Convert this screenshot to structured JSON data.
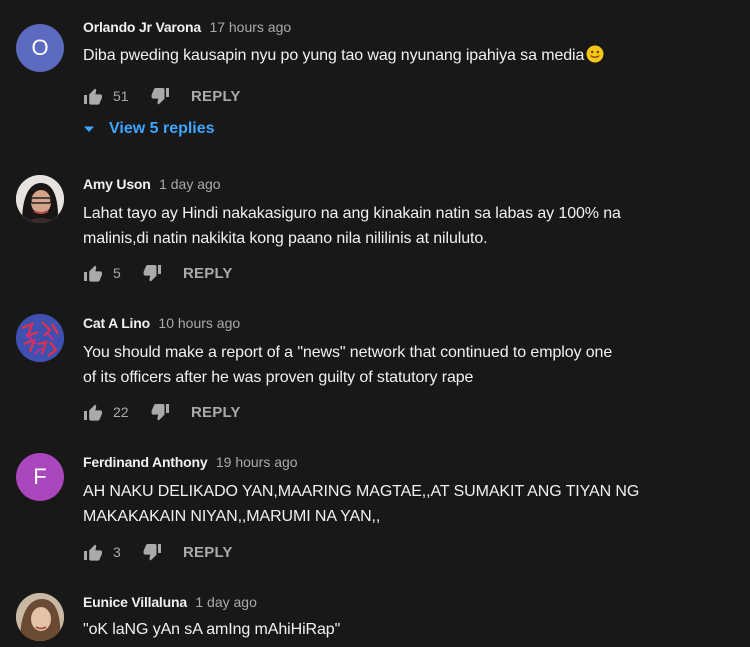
{
  "colors": {
    "background": "#181818",
    "link_blue": "#3ea6ff",
    "muted": "#aaaaaa",
    "text": "#f1f1f1"
  },
  "reply_label": "REPLY",
  "comments": [
    {
      "author": "Orlando Jr Varona",
      "time": "17 hours ago",
      "avatar_letter": "O",
      "avatar_color": "#5c6bc0",
      "text": "Diba pweding kausapin nyu po yung tao wag nyunang ipahiya sa media",
      "text_emoji": "smiling-face-icon",
      "likes": "51",
      "view_replies": "View 5 replies"
    },
    {
      "author": "Amy Uson",
      "time": "1 day ago",
      "avatar_kind": "photo",
      "text_line1": "Lahat tayo ay Hindi nakakasiguro na ang kinakain natin sa labas ay 100% na",
      "text_line2": "malinis,di natin nakikita kong paano nila nililinis at niluluto.",
      "likes": "5"
    },
    {
      "author": "Cat A Lino",
      "time": "10 hours ago",
      "avatar_kind": "pattern",
      "text_line1": "You should make a report of a \"news\" network that continued to employ one",
      "text_line2": "of its officers after he was proven guilty of statutory rape",
      "likes": "22"
    },
    {
      "author": "Ferdinand Anthony",
      "time": "19 hours ago",
      "avatar_letter": "F",
      "avatar_color": "#ab47bc",
      "text_line1": "AH NAKU DELIKADO YAN,MAARING MAGTAE,,AT SUMAKIT ANG TIYAN NG",
      "text_line2": "MAKAKAKAIN NIYAN,,MARUMI NA YAN,,",
      "likes": "3"
    },
    {
      "author": "Eunice Villaluna",
      "time": "1 day ago",
      "avatar_kind": "photo",
      "text": "\"oK laNG yAn sA amIng mAhiHiRap\""
    }
  ]
}
